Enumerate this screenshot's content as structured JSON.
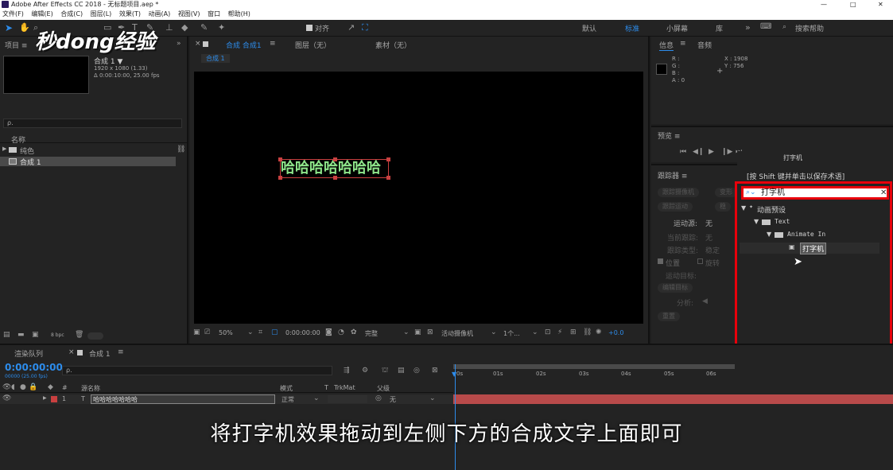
{
  "window": {
    "title": "Adobe After Effects CC 2018 - 无标题项目.aep *",
    "min": "—",
    "max": "□",
    "close": "✕"
  },
  "menu": [
    "文件(F)",
    "编辑(E)",
    "合成(C)",
    "图层(L)",
    "效果(T)",
    "动画(A)",
    "视图(V)",
    "窗口",
    "帮助(H)"
  ],
  "toolbar": {
    "align_label": "对齐",
    "workspaces": [
      "默认",
      "标准",
      "小屏幕",
      "库"
    ],
    "active_workspace": "标准",
    "search_placeholder": "搜索帮助"
  },
  "watermark": "秒dong经验",
  "project": {
    "tab": "项目 ≡",
    "comp_name": "合成 1 ▼",
    "comp_info1": "1920 x 1080 (1.33)",
    "comp_info2": "Δ 0:00:10:00, 25.00 fps",
    "search_placeholder": "ρ.",
    "col_name": "名称",
    "items": [
      {
        "label": "纯色",
        "type": "folder"
      },
      {
        "label": "合成 1",
        "type": "comp"
      }
    ],
    "bpc": "8 bpc"
  },
  "composition": {
    "tab_label": "合成 合成1",
    "layer_tab": "图层（无）",
    "footage_tab": "素材（无）",
    "sub_tab": "合成 1",
    "text_content": "哈哈哈哈哈哈哈",
    "zoom": "50%",
    "timecode": "0:00:00:00",
    "quality": "完整",
    "camera": "活动摄像机",
    "views": "1个...",
    "exposure": "+0.0"
  },
  "info": {
    "tab_info": "信息",
    "tab_audio": "音频",
    "r": "R :",
    "g": "G :",
    "b": "B :",
    "a": "A : 0",
    "x": "X : 1908",
    "y": "Y : 756"
  },
  "preview": {
    "tab": "预览 ≡"
  },
  "tracker": {
    "tab": "跟踪器 ≡",
    "btn1": "跟踪摄像机",
    "btn2": "变形",
    "btn3": "跟踪运动",
    "btn4": "稳",
    "motion_source_label": "运动源:",
    "motion_source_value": "无",
    "current_track_label": "当前跟踪:",
    "current_track_value": "无",
    "track_type_label": "跟踪类型:",
    "track_type_value": "稳定",
    "position": "位置",
    "rotation": "旋转",
    "motion_target": "运动目标:",
    "edit_target": "编辑目标",
    "analyze": "分析:",
    "reset": "重置"
  },
  "effects": {
    "title": "打字机",
    "hint": "[按 Shift 键并单击以保存术语]",
    "search_value": "打字机",
    "tree": [
      {
        "label": "动画预设",
        "depth": 0
      },
      {
        "label": "Text",
        "depth": 1
      },
      {
        "label": "Animate In",
        "depth": 2
      },
      {
        "label": "打字机",
        "depth": 3
      }
    ]
  },
  "timeline": {
    "tab_render": "渲染队列",
    "tab_comp": "合成 1",
    "timecode": "0:00:00:00",
    "fps_info": "00000 (25.00 fps)",
    "search_placeholder": "ρ.",
    "col_num": "#",
    "col_source": "源名称",
    "col_mode": "模式",
    "col_t": "T",
    "col_trkmat": "TrkMat",
    "col_parent": "父级",
    "layer_num": "1",
    "layer_type": "T",
    "layer_name": "哈哈哈哈哈哈哈",
    "layer_mode": "正常",
    "layer_parent": "无",
    "ruler": [
      "0s",
      "01s",
      "02s",
      "03s",
      "04s",
      "05s",
      "06s"
    ]
  },
  "subtitle": "将打字机效果拖动到左侧下方的合成文字上面即可",
  "colors": {
    "accent_blue": "#2d8ceb",
    "highlight_red": "#e8000b",
    "text_fill": "#8ee58a",
    "layer_label": "#c94040"
  }
}
